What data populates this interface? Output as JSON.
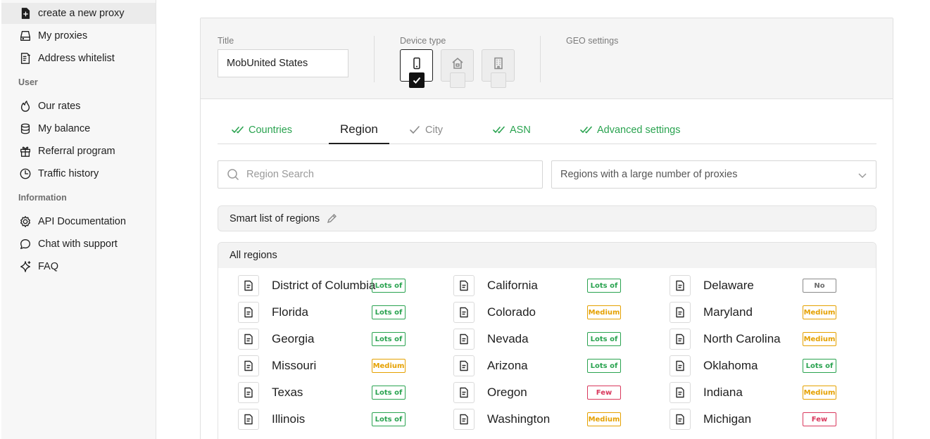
{
  "sidebar": {
    "items": [
      {
        "label": "create a new proxy",
        "icon": "file-plus-icon",
        "active": true
      },
      {
        "label": "My proxies",
        "icon": "drive-icon"
      },
      {
        "label": "Address whitelist",
        "icon": "list-icon"
      }
    ],
    "user_title": "User",
    "user_items": [
      {
        "label": "Our rates",
        "icon": "flame-icon"
      },
      {
        "label": "My balance",
        "icon": "database-icon"
      },
      {
        "label": "Referral program",
        "icon": "gift-icon"
      },
      {
        "label": "Traffic history",
        "icon": "clock-icon"
      }
    ],
    "info_title": "Information",
    "info_items": [
      {
        "label": "API Documentation",
        "icon": "gear-icon"
      },
      {
        "label": "Chat with support",
        "icon": "chat-icon"
      },
      {
        "label": "FAQ",
        "icon": "sparkle-icon"
      }
    ]
  },
  "header": {
    "title_label": "Title",
    "title_value": "MobUnited States",
    "device_type_label": "Device type",
    "geo_label": "GEO settings",
    "devices": [
      {
        "name": "mobile-icon",
        "selected": true
      },
      {
        "name": "home-icon",
        "selected": false
      },
      {
        "name": "building-icon",
        "selected": false
      }
    ]
  },
  "tabs": [
    {
      "label": "Countries",
      "state": "done"
    },
    {
      "label": "Region",
      "state": "active"
    },
    {
      "label": "City",
      "state": "pending"
    },
    {
      "label": "ASN",
      "state": "done"
    },
    {
      "label": "Advanced settings",
      "state": "done"
    }
  ],
  "search": {
    "placeholder": "Region Search",
    "value": ""
  },
  "filter": {
    "selected": "Regions with a large number of proxies"
  },
  "smart_list": {
    "label": "Smart list of regions"
  },
  "all_regions": {
    "label": "All regions",
    "columns": [
      [
        {
          "name": "District of Columbia",
          "badge": "Lots of",
          "level": "lots"
        },
        {
          "name": "Florida",
          "badge": "Lots of",
          "level": "lots"
        },
        {
          "name": "Georgia",
          "badge": "Lots of",
          "level": "lots"
        },
        {
          "name": "Missouri",
          "badge": "Medium",
          "level": "medium"
        },
        {
          "name": "Texas",
          "badge": "Lots of",
          "level": "lots"
        },
        {
          "name": "Illinois",
          "badge": "Lots of",
          "level": "lots"
        }
      ],
      [
        {
          "name": "California",
          "badge": "Lots of",
          "level": "lots"
        },
        {
          "name": "Colorado",
          "badge": "Medium",
          "level": "medium"
        },
        {
          "name": "Nevada",
          "badge": "Lots of",
          "level": "lots"
        },
        {
          "name": "Arizona",
          "badge": "Lots of",
          "level": "lots"
        },
        {
          "name": "Oregon",
          "badge": "Few",
          "level": "few"
        },
        {
          "name": "Washington",
          "badge": "Medium",
          "level": "medium"
        }
      ],
      [
        {
          "name": "Delaware",
          "badge": "No",
          "level": "no"
        },
        {
          "name": "Maryland",
          "badge": "Medium",
          "level": "medium"
        },
        {
          "name": "North Carolina",
          "badge": "Medium",
          "level": "medium"
        },
        {
          "name": "Oklahoma",
          "badge": "Lots of",
          "level": "lots"
        },
        {
          "name": "Indiana",
          "badge": "Medium",
          "level": "medium"
        },
        {
          "name": "Michigan",
          "badge": "Few",
          "level": "few"
        }
      ]
    ]
  },
  "colors": {
    "done": "#2aa350",
    "medium": "#e5a100",
    "few": "#d9385d",
    "no": "#6a6a6a"
  }
}
